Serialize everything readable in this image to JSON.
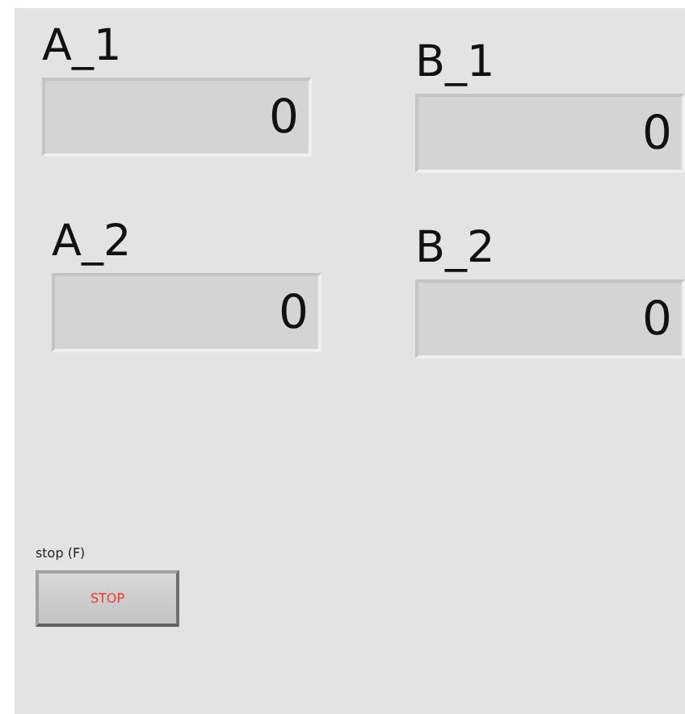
{
  "indicators": [
    {
      "label": "A_1",
      "value": "0"
    },
    {
      "label": "B_1",
      "value": "0"
    },
    {
      "label": "A_2",
      "value": "0"
    },
    {
      "label": "B_2",
      "value": "0"
    }
  ],
  "stop_button": {
    "label": "stop (F)",
    "text": "STOP"
  }
}
